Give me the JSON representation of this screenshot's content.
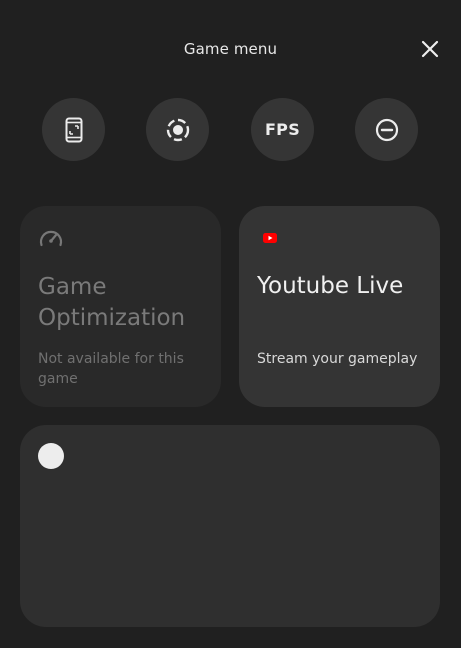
{
  "header": {
    "title": "Game menu",
    "close_icon": "close-icon"
  },
  "quick_actions": [
    {
      "icon": "screenshot-phone-icon"
    },
    {
      "icon": "screen-record-icon"
    },
    {
      "label": "FPS"
    },
    {
      "icon": "do-not-disturb-icon"
    }
  ],
  "cards": {
    "optimization": {
      "icon": "gauge-icon",
      "title": "Game Optimization",
      "subtitle": "Not available for this game"
    },
    "youtube": {
      "icon": "youtube-icon",
      "title": "Youtube Live",
      "subtitle": "Stream your gameplay",
      "brand_color": "#ff0000"
    },
    "widget": {
      "icon": "circle-icon"
    }
  },
  "colors": {
    "background": "#202020",
    "button": "#353535",
    "card": "#2e2e2e"
  }
}
